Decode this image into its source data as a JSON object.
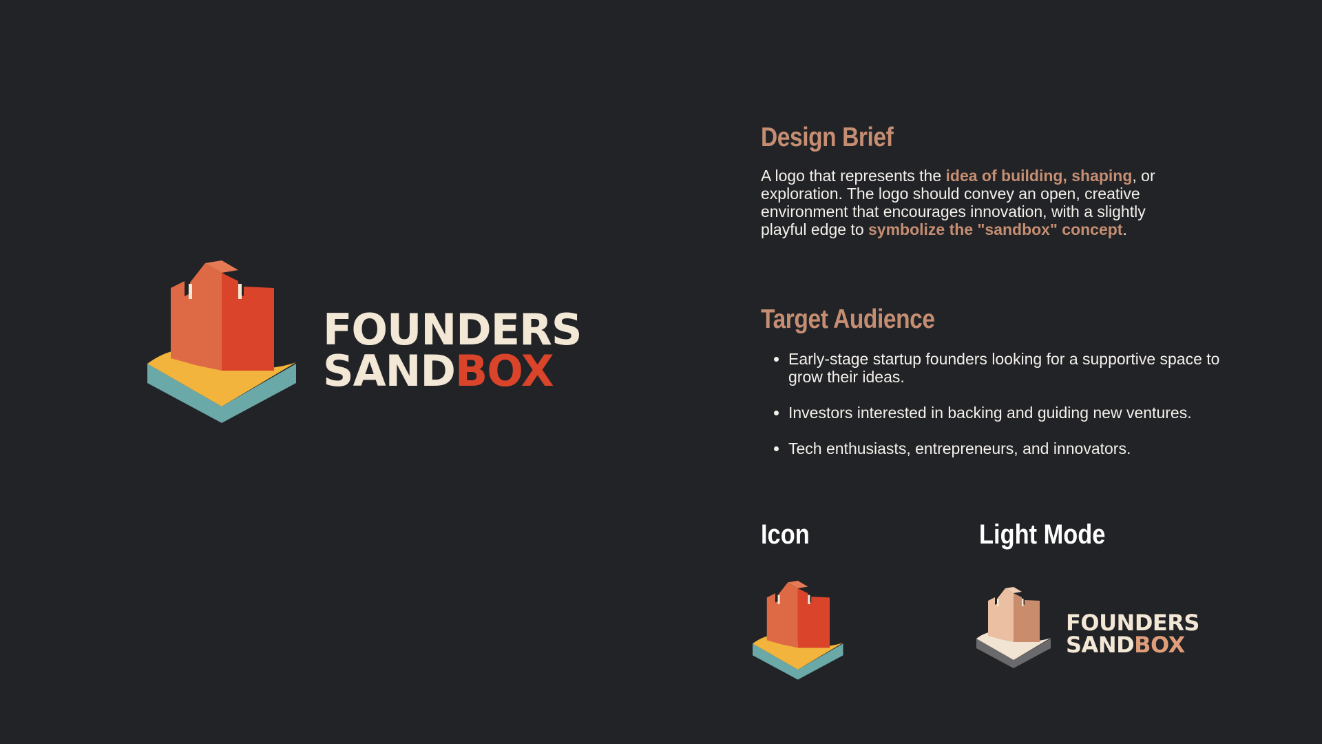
{
  "logo": {
    "word_line1": "FOUNDERS",
    "word_sand": "SAND",
    "word_box": "BOX"
  },
  "design_brief": {
    "title": "Design Brief",
    "text_1": "A logo that represents the ",
    "highlight_1": "idea of building, shaping",
    "text_2": ", or exploration. The logo should convey an open, creative environment that encourages innovation, with a slightly playful edge to ",
    "highlight_2": "symbolize the \"sandbox\" concept",
    "text_3": "."
  },
  "target_audience": {
    "title": "Target Audience",
    "items": [
      "Early-stage startup founders looking for a supportive space to grow their ideas.",
      "Investors interested in backing and guiding new ventures.",
      "Tech enthusiasts, entrepreneurs, and innovators."
    ]
  },
  "icon_section": {
    "title": "Icon"
  },
  "light_mode_section": {
    "title": "Light Mode",
    "word_line1": "FOUNDERS",
    "word_sand": "SAND",
    "word_box": "BOX"
  },
  "colors": {
    "background": "#222326",
    "accent": "#c58e73",
    "tower_light": "#e0633d",
    "tower_dark": "#d9442a",
    "sand": "#f2b43c",
    "base": "#6aa9a8"
  }
}
